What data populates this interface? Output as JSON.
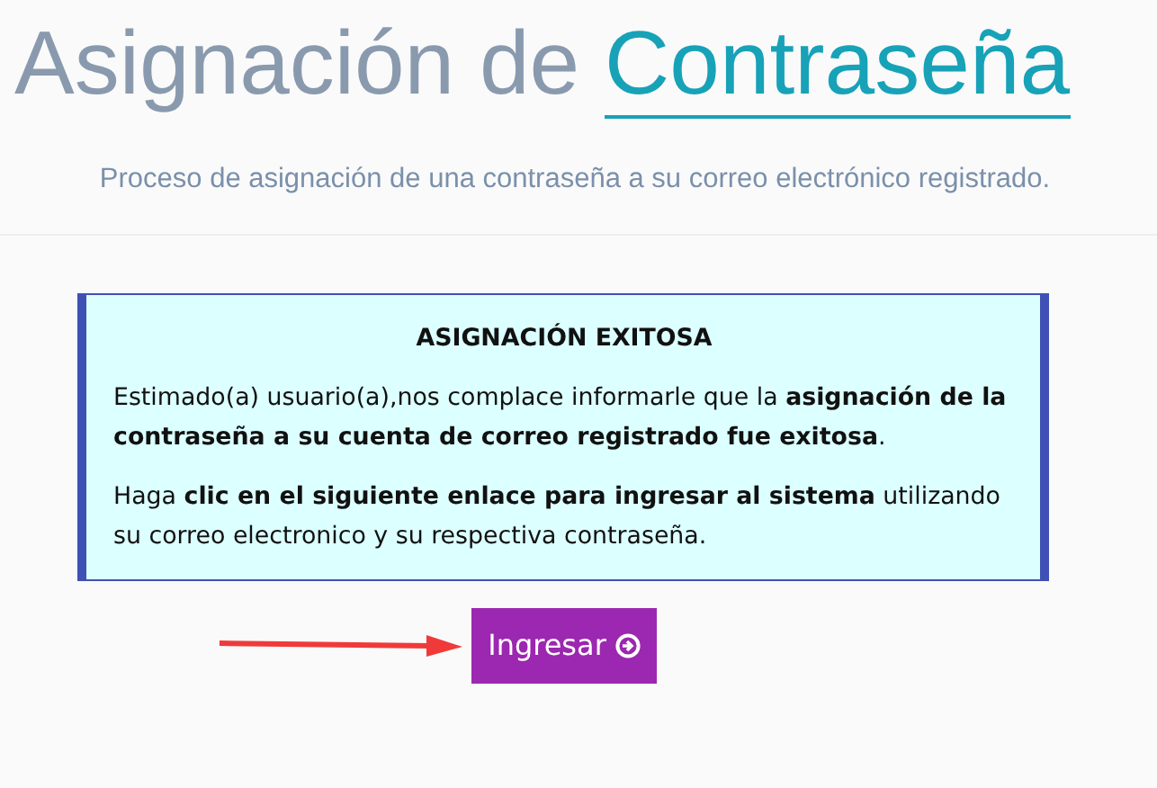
{
  "title": {
    "lead": "Asignación de",
    "highlight": "Contraseña"
  },
  "subtitle": "Proceso de asignación de una contraseña a su correo electrónico registrado.",
  "notice": {
    "heading": "ASIGNACIÓN EXITOSA",
    "paragraphs": [
      "Estimado(a) usuario(a),nos complace informarle que la **asignación de la contraseña a su cuenta de correo registrado fue exitosa**.",
      "Haga **clic en el siguiente enlace para ingresar al sistema** utilizando su correo electronico y su respectiva contraseña."
    ]
  },
  "button": {
    "label": "Ingresar"
  }
}
